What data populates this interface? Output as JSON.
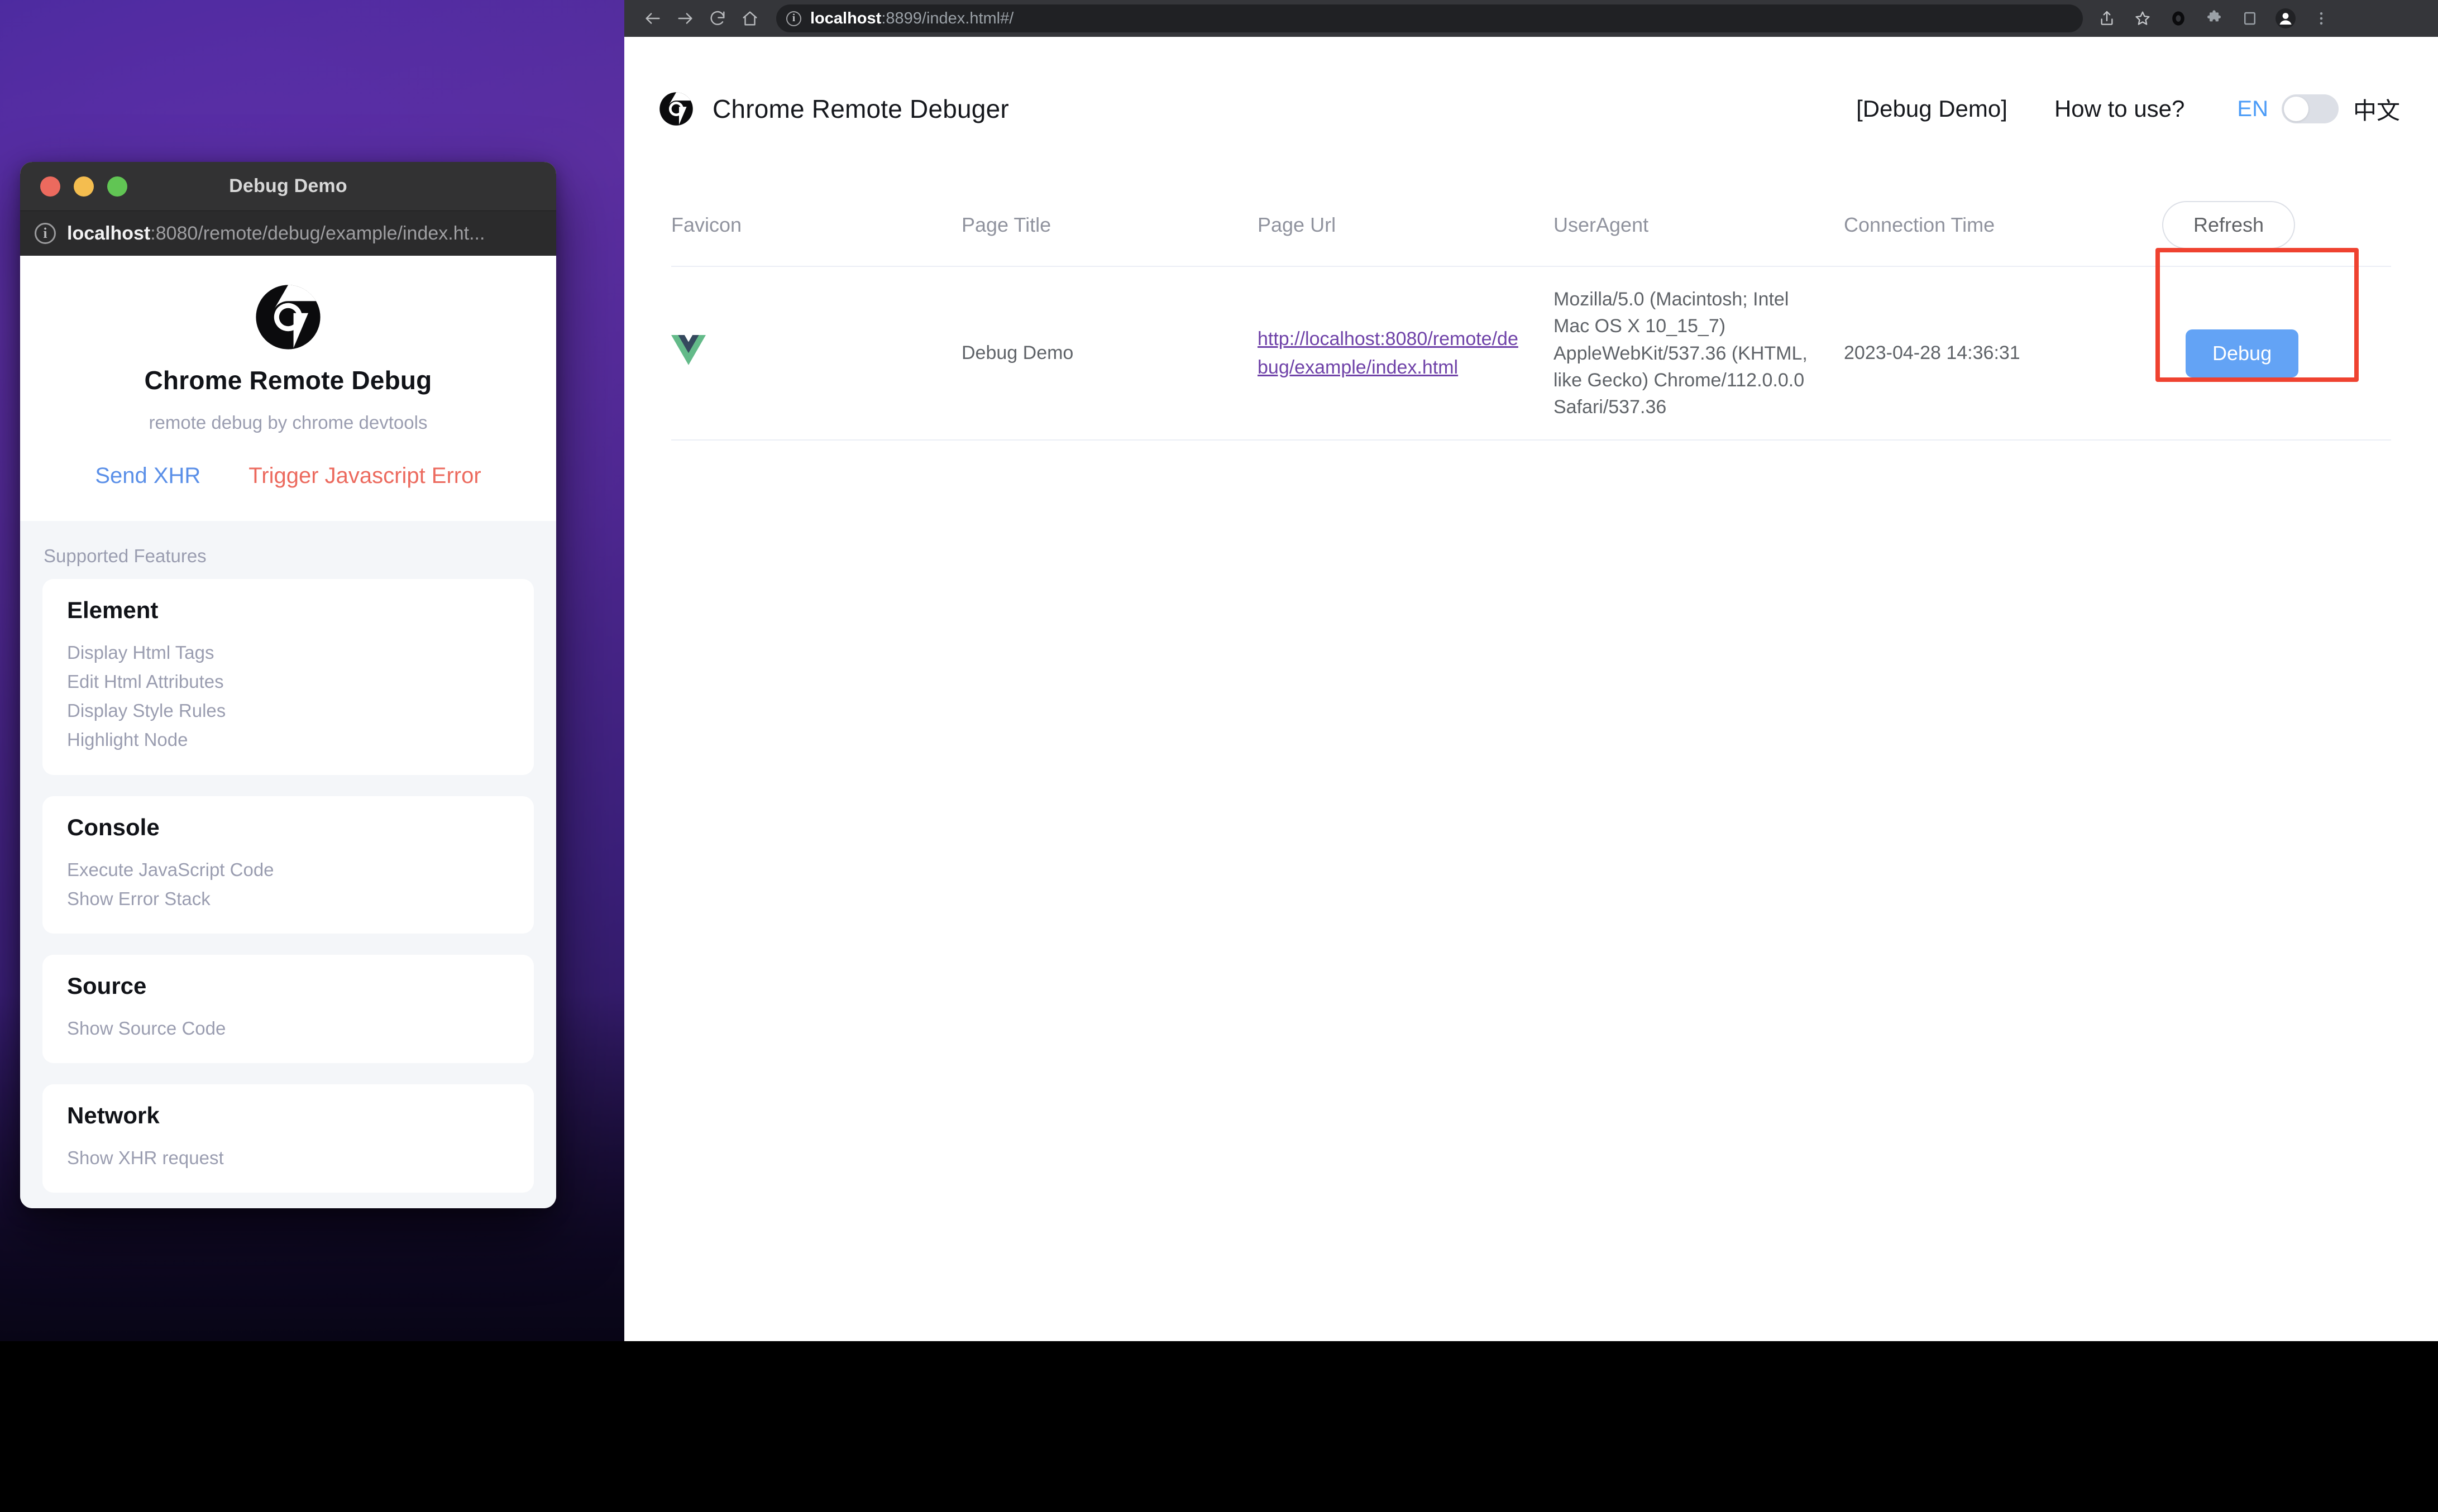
{
  "desktop": {
    "demo_window": {
      "title": "Debug Demo",
      "url_host": "localhost",
      "url_rest": ":8080/remote/debug/example/index.ht...",
      "hero": {
        "logo": "chrome-logo",
        "heading": "Chrome Remote Debug",
        "subheading": "remote debug by chrome devtools",
        "actions": [
          {
            "label": "Send XHR",
            "color": "#5a8fe8"
          },
          {
            "label": "Trigger Javascript Error",
            "color": "#ec6a5e"
          }
        ]
      },
      "features_label": "Supported Features",
      "features": [
        {
          "title": "Element",
          "items": [
            "Display Html Tags",
            "Edit Html Attributes",
            "Display Style Rules",
            "Highlight Node"
          ]
        },
        {
          "title": "Console",
          "items": [
            "Execute JavaScript Code",
            "Show Error Stack"
          ]
        },
        {
          "title": "Source",
          "items": [
            "Show Source Code"
          ]
        },
        {
          "title": "Network",
          "items": [
            "Show XHR request"
          ]
        }
      ],
      "traffic_lights": [
        "close-red",
        "minimize-yellow",
        "maximize-green"
      ]
    }
  },
  "browser": {
    "toolbar": {
      "back": "back-arrow-icon",
      "forward": "forward-arrow-icon",
      "reload": "reload-icon",
      "home": "home-icon",
      "url_host": "localhost",
      "url_rest": ":8899/index.html#/",
      "share": "share-icon",
      "bookmark": "star-icon",
      "extension_o": "o-extension-icon",
      "puzzle": "puzzle-icon",
      "sidepanel": "side-panel-icon",
      "profile": "profile-avatar-icon",
      "menu": "three-dot-menu-icon"
    }
  },
  "page": {
    "brand": {
      "logo": "chrome-logo",
      "title": "Chrome Remote Debuger"
    },
    "nav": {
      "debug_demo": "[Debug Demo]",
      "how_to_use": "How to use?",
      "lang_en": "EN",
      "lang_zh": "中文"
    },
    "table": {
      "columns": [
        "Favicon",
        "Page Title",
        "Page Url",
        "UserAgent",
        "Connection Time"
      ],
      "refresh_label": "Refresh",
      "rows": [
        {
          "favicon": "vue-logo-icon",
          "page_title": "Debug Demo",
          "page_url": "http://localhost:8080/remote/debug/example/index.html",
          "user_agent": "Mozilla/5.0 (Macintosh; Intel Mac OS X 10_15_7) AppleWebKit/537.36 (KHTML, like Gecko) Chrome/112.0.0.0 Safari/537.36",
          "connection_time": "2023-04-28 14:36:31",
          "action_label": "Debug"
        }
      ]
    },
    "colors": {
      "accent_blue": "#63a3f5",
      "link_purple": "#6f42a8",
      "highlight_red": "#ef4230",
      "lang_active": "#4a9bf7"
    }
  }
}
